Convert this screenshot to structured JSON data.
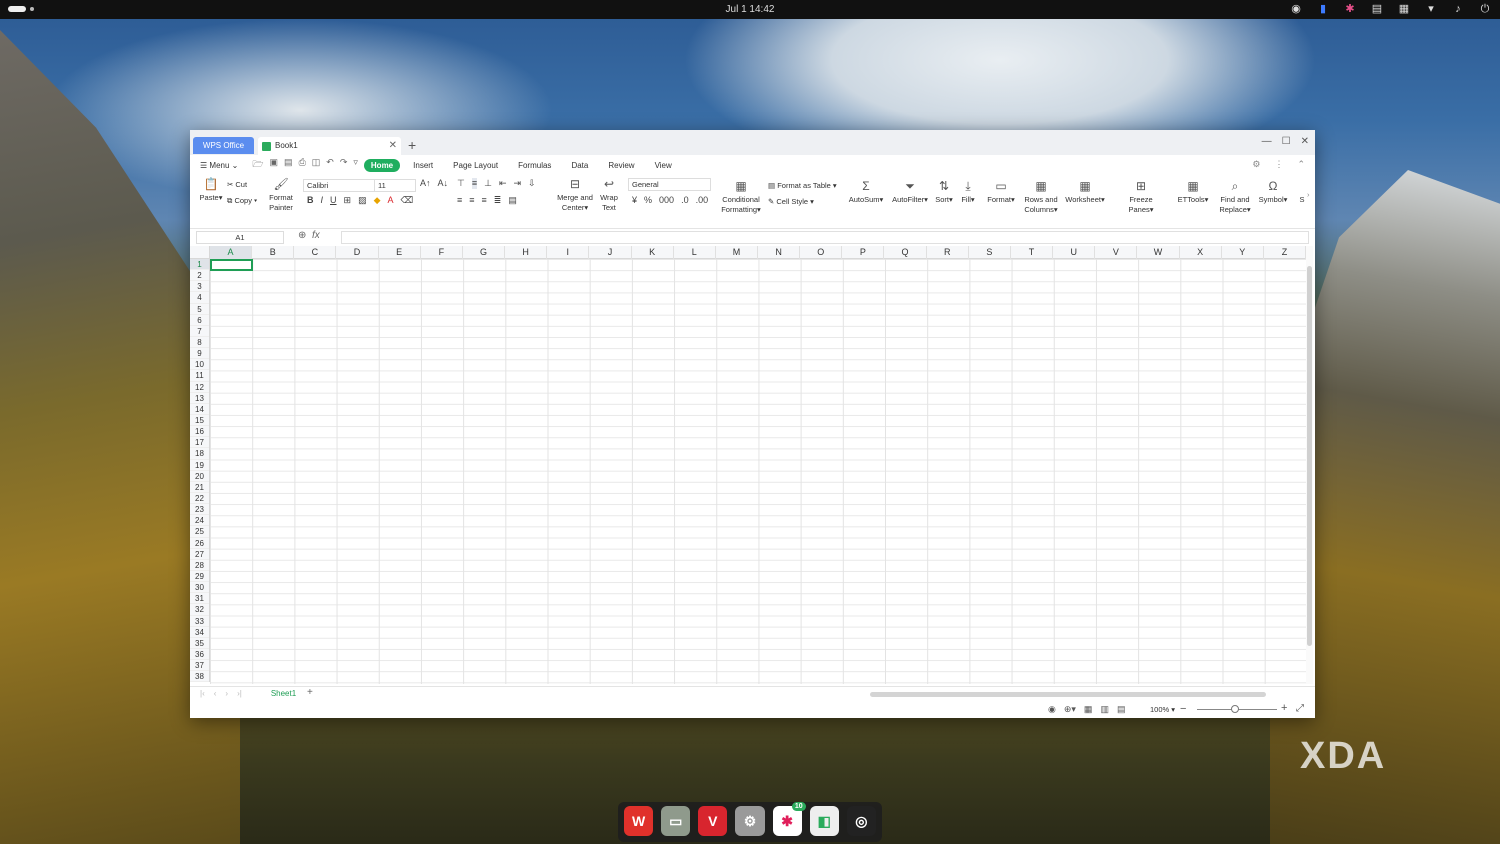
{
  "topbar": {
    "clock": "Jul 1  14:42"
  },
  "titlebar": {
    "tab_wps": "WPS Office",
    "tab_book": "Book1"
  },
  "menu": {
    "menu_label": "Menu",
    "tabs": [
      "Home",
      "Insert",
      "Page Layout",
      "Formulas",
      "Data",
      "Review",
      "View"
    ]
  },
  "ribbon": {
    "paste": "Paste",
    "cut": "Cut",
    "copy": "Copy",
    "format_painter_1": "Format",
    "format_painter_2": "Painter",
    "font_name": "Calibri",
    "font_size": "11",
    "merge_1": "Merge and",
    "merge_2": "Center",
    "wrap_1": "Wrap",
    "wrap_2": "Text",
    "number_format": "General",
    "cond_1": "Conditional",
    "cond_2": "Formatting",
    "format_table": "Format as Table",
    "cell_style": "Cell Style",
    "autosum": "AutoSum",
    "autofilter": "AutoFilter",
    "sort": "Sort",
    "fill": "Fill",
    "format": "Format",
    "rows_1": "Rows and",
    "rows_2": "Columns",
    "worksheet": "Worksheet",
    "freeze": "Freeze Panes",
    "ettools": "ETTools",
    "find_1": "Find and",
    "find_2": "Replace",
    "symbol": "Symbol",
    "more": "S"
  },
  "formula": {
    "namebox": "A1",
    "fx": "fx"
  },
  "grid": {
    "columns": [
      "A",
      "B",
      "C",
      "D",
      "E",
      "F",
      "G",
      "H",
      "I",
      "J",
      "K",
      "L",
      "M",
      "N",
      "O",
      "P",
      "Q",
      "R",
      "S",
      "T",
      "U",
      "V",
      "W",
      "X",
      "Y",
      "Z"
    ],
    "rows": [
      "1",
      "2",
      "3",
      "4",
      "5",
      "6",
      "7",
      "8",
      "9",
      "10",
      "11",
      "12",
      "13",
      "14",
      "15",
      "16",
      "17",
      "18",
      "19",
      "20",
      "21",
      "22",
      "23",
      "24",
      "25",
      "26",
      "27",
      "28",
      "29",
      "30",
      "31",
      "32",
      "33",
      "34",
      "35",
      "36",
      "37",
      "38"
    ]
  },
  "sheetbar": {
    "sheet1": "Sheet1"
  },
  "status": {
    "zoom": "100%"
  },
  "dock": {
    "badge": "10"
  },
  "watermark": "XDA",
  "colors": {
    "accent": "#1fae5f",
    "wps_tab": "#5b8def"
  }
}
